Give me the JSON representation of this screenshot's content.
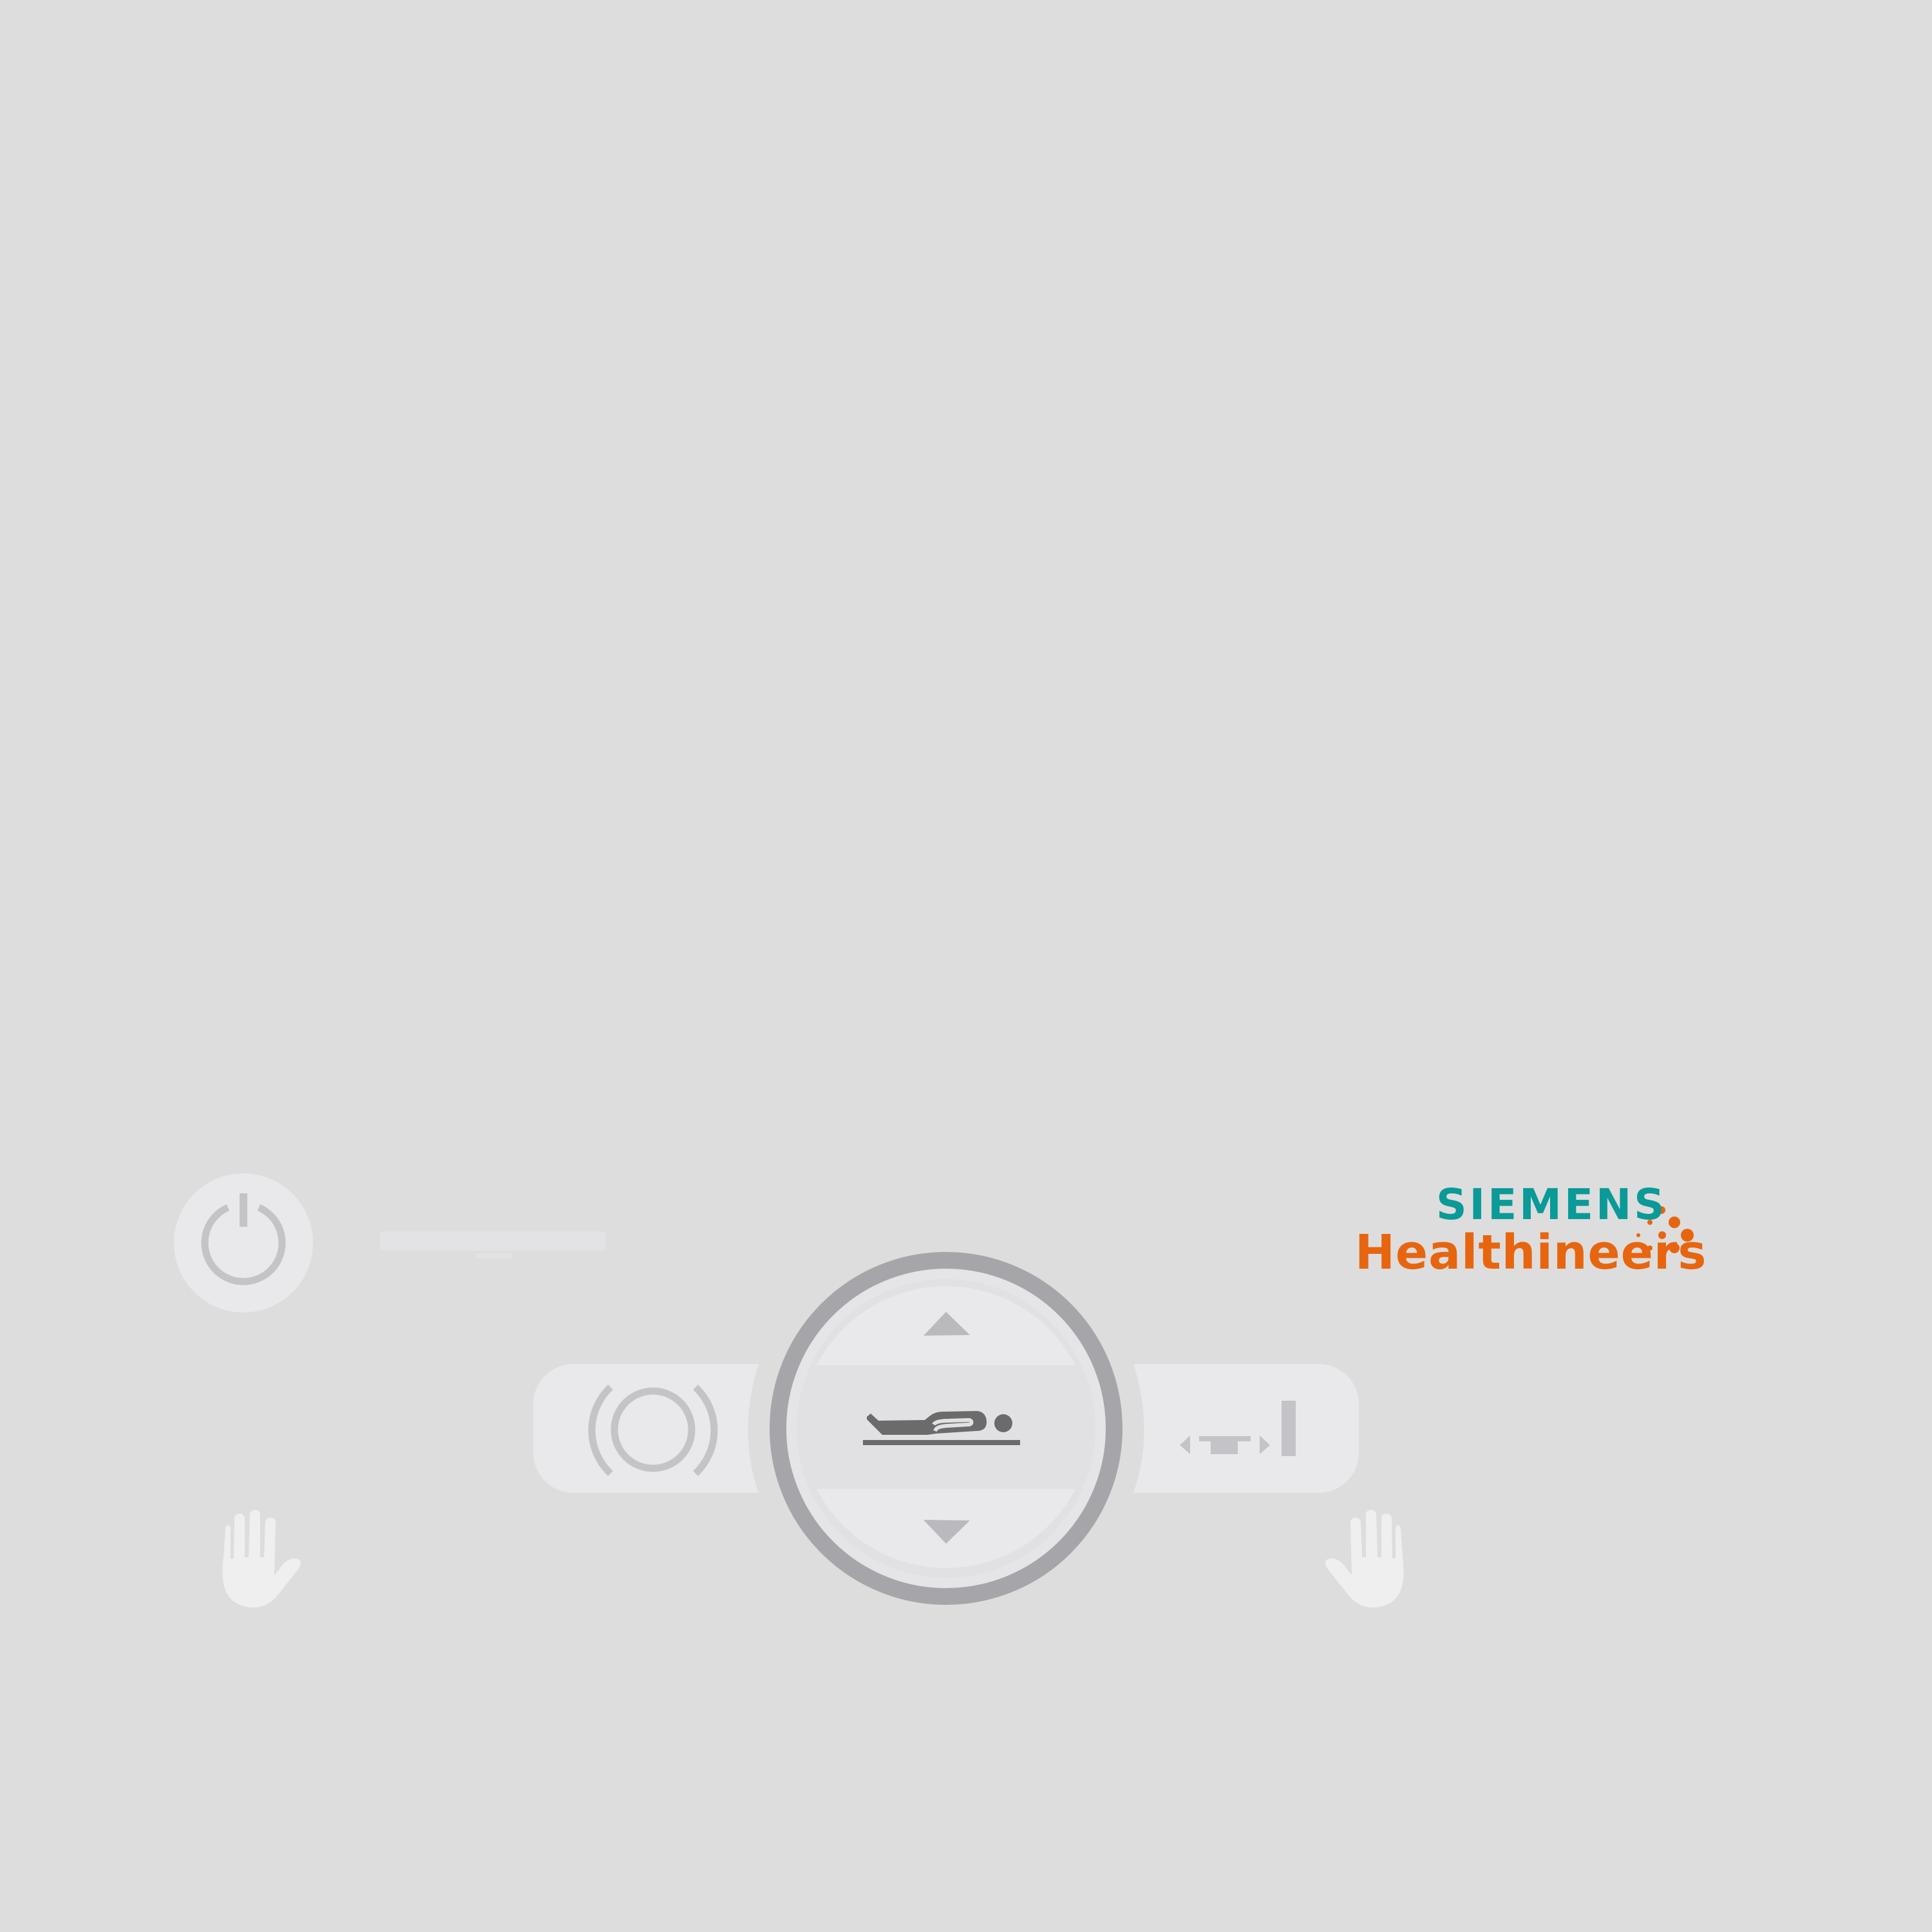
{
  "brand": {
    "name": "SIEMENS",
    "subname": "Healthineers",
    "primary_color": "#0a9a97",
    "secondary_color": "#e8650f"
  },
  "colors": {
    "background": "#dddddd",
    "panel": "#e9e9ec",
    "ring": "#a6a6aa",
    "icon_gray": "#c3c3c8",
    "icon_dark": "#6b6b6b",
    "hand": "#efefef"
  },
  "controls": {
    "power": {
      "icon": "power-icon"
    },
    "status_bar": {
      "icon": "status-indicator"
    },
    "left_stop": {
      "icon": "stop-hand-icon"
    },
    "right_stop": {
      "icon": "stop-hand-icon"
    },
    "home": {
      "icon": "home-position-icon"
    },
    "table_up": {
      "icon": "arrow-up-icon"
    },
    "table_down": {
      "icon": "arrow-down-icon"
    },
    "patient_position": {
      "icon": "patient-on-table-icon"
    },
    "move_to_gantry": {
      "icon": "table-move-icon"
    }
  }
}
